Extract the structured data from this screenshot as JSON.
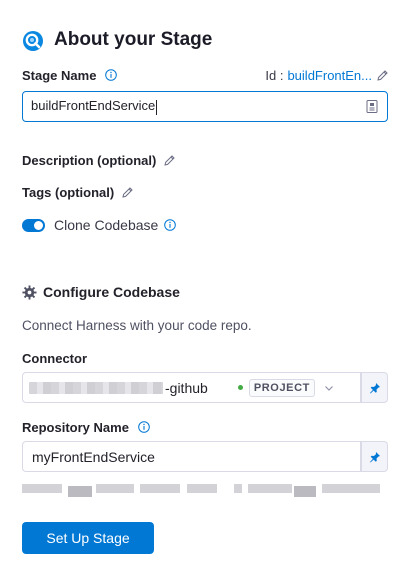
{
  "header": {
    "title": "About your Stage",
    "logo_icon": "stage-logo-icon"
  },
  "stage_name": {
    "label": "Stage Name",
    "value": "buildFrontEndService",
    "id_label": "Id :",
    "id_value": "buildFrontEn..."
  },
  "description": {
    "label": "Description (optional)"
  },
  "tags": {
    "label": "Tags (optional)"
  },
  "clone_codebase": {
    "label": "Clone Codebase",
    "enabled": true
  },
  "configure": {
    "title": "Configure Codebase",
    "subtitle": "Connect Harness with your code repo.",
    "connector_label": "Connector",
    "connector_name_suffix": "-github",
    "connector_scope": "PROJECT",
    "repo_label": "Repository Name",
    "repo_value": "myFrontEndService"
  },
  "actions": {
    "submit": "Set Up Stage"
  },
  "colors": {
    "accent": "#0278d5",
    "status_ok": "#42ab45",
    "text": "#22222a"
  }
}
